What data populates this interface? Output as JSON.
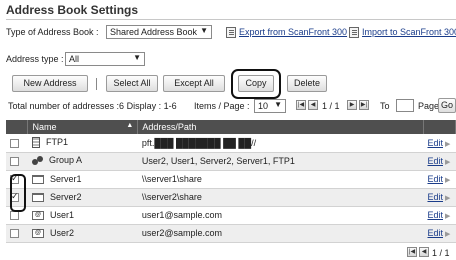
{
  "page": {
    "title": "Address Book Settings"
  },
  "type_row": {
    "type_label": "Type of Address Book :",
    "type_value": "Shared Address Book",
    "export_link": "Export from ScanFront 300",
    "import_link": "Import to ScanFront 300"
  },
  "address_type": {
    "label": "Address type :",
    "value": "All"
  },
  "toolbar": {
    "new_address": "New Address",
    "select_all": "Select All",
    "except_all": "Except All",
    "copy": "Copy",
    "delete": "Delete"
  },
  "status": {
    "summary": "Total number of addresses :6 Display : 1-6",
    "items_per_page_label": "Items / Page :",
    "items_per_page_value": "10",
    "page_indicator": "1 / 1",
    "to_label": "To",
    "page_label": "Page",
    "go_label": "Go"
  },
  "table": {
    "col_name": "Name",
    "col_sort_marker": "▲",
    "col_address": "Address/Path",
    "edit_label": "Edit",
    "rows": [
      {
        "checked": false,
        "icon": "ftp-icon",
        "name": "FTP1",
        "address": "pft.███ ███████ ██ ██//"
      },
      {
        "checked": false,
        "icon": "group-icon",
        "name": "Group A",
        "address": "User2, User1, Server2, Server1, FTP1"
      },
      {
        "checked": true,
        "icon": "folder-icon",
        "name": "Server1",
        "address": "\\\\server1\\share"
      },
      {
        "checked": true,
        "icon": "folder-icon",
        "name": "Server2",
        "address": "\\\\server2\\share"
      },
      {
        "checked": false,
        "icon": "mail-icon",
        "name": "User1",
        "address": "user1@sample.com"
      },
      {
        "checked": false,
        "icon": "mail-icon",
        "name": "User2",
        "address": "user2@sample.com"
      }
    ]
  },
  "footer": {
    "page_indicator": "1 / 1"
  }
}
